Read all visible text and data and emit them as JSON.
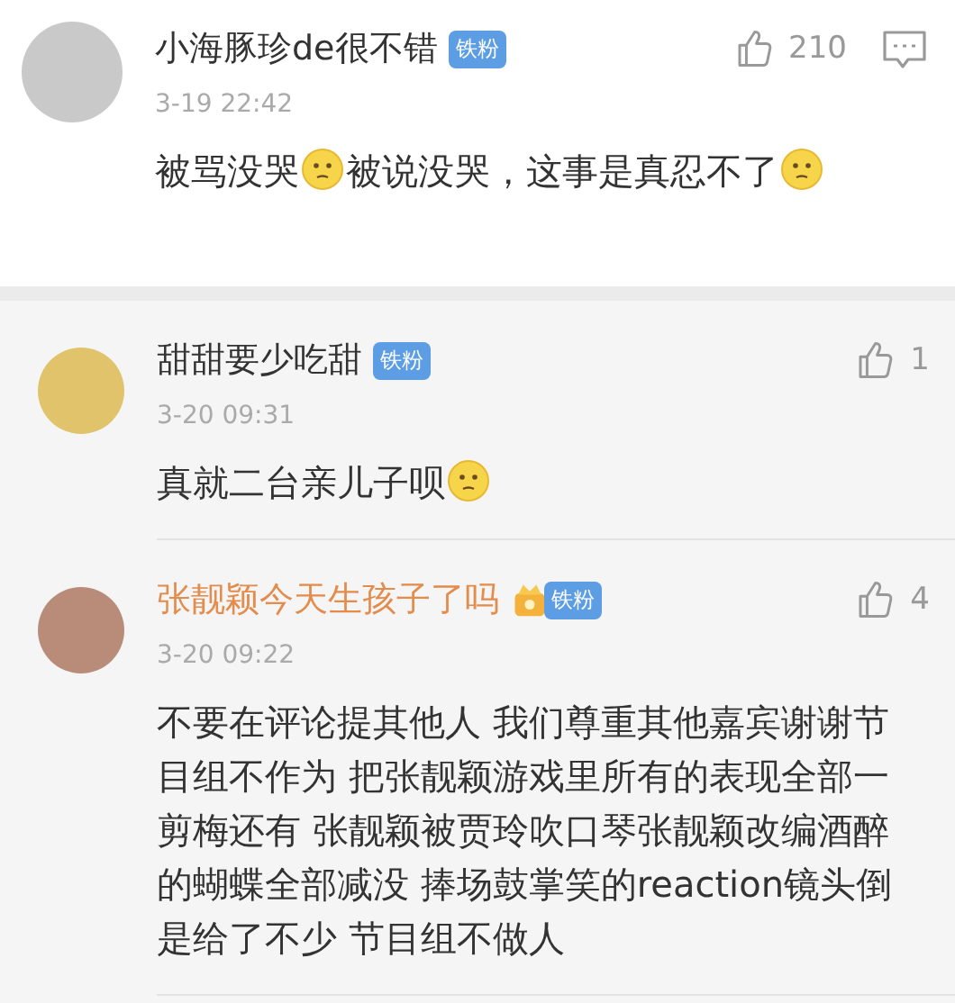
{
  "comments": [
    {
      "kind": "top",
      "name": "小海豚珍de很不错",
      "color": "#333333",
      "crown_badge": false,
      "badge": "铁粉",
      "time": "3-19 22:42",
      "likes": "210",
      "body": [
        {
          "kind": "text",
          "text": "被骂没哭"
        },
        {
          "kind": "emoji"
        },
        {
          "kind": "text",
          "text": "被说没哭，这事是真忍不了"
        },
        {
          "kind": "emoji"
        }
      ]
    },
    {
      "kind": "reply",
      "name": "甜甜要少吃甜",
      "color": "#333333",
      "crown_badge": false,
      "badge": "铁粉",
      "time": "3-20 09:31",
      "likes": "1",
      "body": [
        {
          "kind": "text",
          "text": "真就二台亲儿子呗"
        },
        {
          "kind": "emoji"
        }
      ]
    },
    {
      "kind": "reply",
      "name": "张靓颖今天生孩子了吗",
      "color": "#e38c4c",
      "crown_badge": true,
      "badge": "铁粉",
      "time": "3-20 09:22",
      "likes": "4",
      "body": [
        {
          "kind": "text",
          "text": "不要在评论提其他人 我们尊重其他嘉宾谢谢节目组不作为 把张靓颖游戏里所有的表现全部一剪梅还有 张靓颖被贾玲吹口琴张靓颖改编酒醉的蝴蝶全部减没 捧场鼓掌笑的reaction镜头倒是给了不少 节目组不做人"
        }
      ]
    }
  ]
}
